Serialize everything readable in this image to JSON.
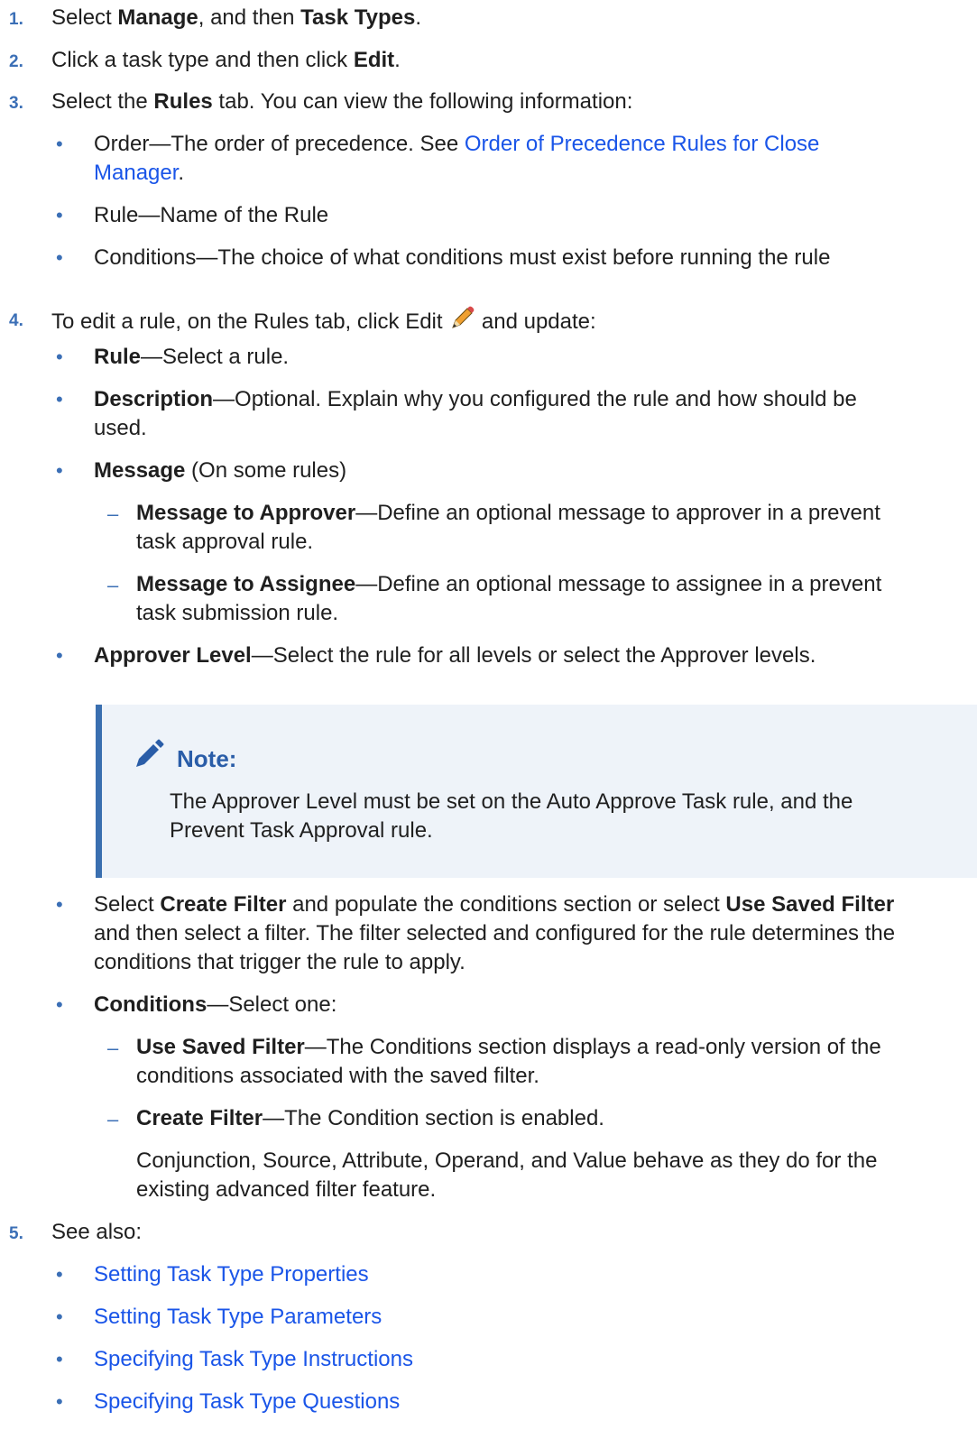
{
  "steps": [
    {
      "num": "1.",
      "a": "Select ",
      "b1": "Manage",
      "c": ", and then ",
      "b2": "Task Types",
      "d": "."
    },
    {
      "num": "2.",
      "a": "Click a task type and then click ",
      "b1": "Edit",
      "d": "."
    },
    {
      "num": "3.",
      "a": "Select the ",
      "b1": "Rules",
      "c": " tab. You can view the following information:"
    },
    {
      "num": "4.",
      "a": "To edit a rule, on the Rules tab, click Edit ",
      "c": " and update:"
    },
    {
      "num": "5.",
      "a": "See also:"
    }
  ],
  "step3_bullets": {
    "order_a": "Order—The order of precedence. See ",
    "order_link1": "Order of Precedence Rules for Close",
    "order_link2": "Manager",
    "order_end": ".",
    "rule": "Rule—Name of the Rule",
    "conditions": "Conditions—The choice of what conditions must exist before running the rule"
  },
  "step4": {
    "rule_b": "Rule",
    "rule_t": "—Select a rule.",
    "desc_b": "Description",
    "desc_t1": "—Optional. Explain why you configured the rule and how should be",
    "desc_t2": "used.",
    "msg_b": "Message",
    "msg_t": " (On some rules)",
    "mta_b": "Message to Approver",
    "mta_t1": "—Define an optional message to approver in a prevent",
    "mta_t2": "task approval rule.",
    "mts_b": "Message to Assignee",
    "mts_t1": "—Define an optional message to assignee in a prevent",
    "mts_t2": "task submission rule.",
    "al_b": "Approver Level",
    "al_t": "—Select the rule for all levels or select the Approver levels.",
    "note_title": "Note:",
    "note_l1": "The Approver Level must be set on the Auto Approve Task rule, and the",
    "note_l2": "Prevent Task Approval rule.",
    "sel_a": "Select ",
    "sel_b1": "Create Filter",
    "sel_c": " and populate the conditions section or select ",
    "sel_b2": "Use Saved Filter",
    "sel_l2": "and then select a filter. The filter selected and configured for the rule determines the",
    "sel_l3": "conditions that trigger the rule to apply.",
    "cond_b": "Conditions",
    "cond_t": "—Select one:",
    "usf_b": "Use Saved Filter",
    "usf_t1": "—The Conditions section displays a read-only version of the",
    "usf_t2": "conditions associated with the saved filter.",
    "cf_b": "Create Filter",
    "cf_t": "—The Condition section is enabled.",
    "conj_l1": "Conjunction, Source, Attribute, Operand, and Value behave as they do for the",
    "conj_l2": "existing advanced filter feature."
  },
  "see_also": [
    "Setting Task Type Properties",
    "Setting Task Type Parameters",
    "Specifying Task Type Instructions",
    "Specifying Task Type Questions"
  ],
  "icons": {
    "edit": "pencil-icon",
    "note": "pencil-icon"
  },
  "colors": {
    "link": "#1a55e8",
    "accent": "#3b6fb6",
    "note_bg": "#eef3f9",
    "note_bar": "#3a6fb0"
  }
}
